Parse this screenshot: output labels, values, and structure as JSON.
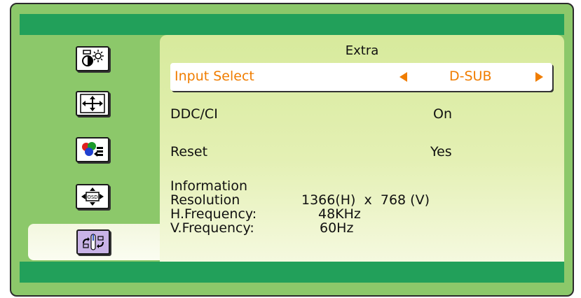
{
  "menu": {
    "title": "Extra",
    "sidebar_items": [
      {
        "icon": "brightness-contrast-icon",
        "selected": false
      },
      {
        "icon": "position-icon",
        "selected": false
      },
      {
        "icon": "color-icon",
        "selected": false
      },
      {
        "icon": "osd-settings-icon",
        "selected": false
      },
      {
        "icon": "extra-icon",
        "selected": true
      }
    ],
    "rows": {
      "input_select": {
        "label": "Input Select",
        "value": "D-SUB"
      },
      "ddc_ci": {
        "label": "DDC/CI",
        "value": "On"
      },
      "reset": {
        "label": "Reset",
        "value": "Yes"
      }
    },
    "information": {
      "heading": "Information",
      "resolution_label": "Resolution",
      "resolution_value": "1366(H)  x  768 (V)",
      "hfreq_label": "H.Frequency:",
      "hfreq_value": "48KHz",
      "vfreq_label": "V.Frequency:",
      "vfreq_value": "60Hz"
    }
  },
  "colors": {
    "frame_bg": "#8cc86a",
    "bars": "#22a05a",
    "highlight_text": "#f07d00"
  }
}
